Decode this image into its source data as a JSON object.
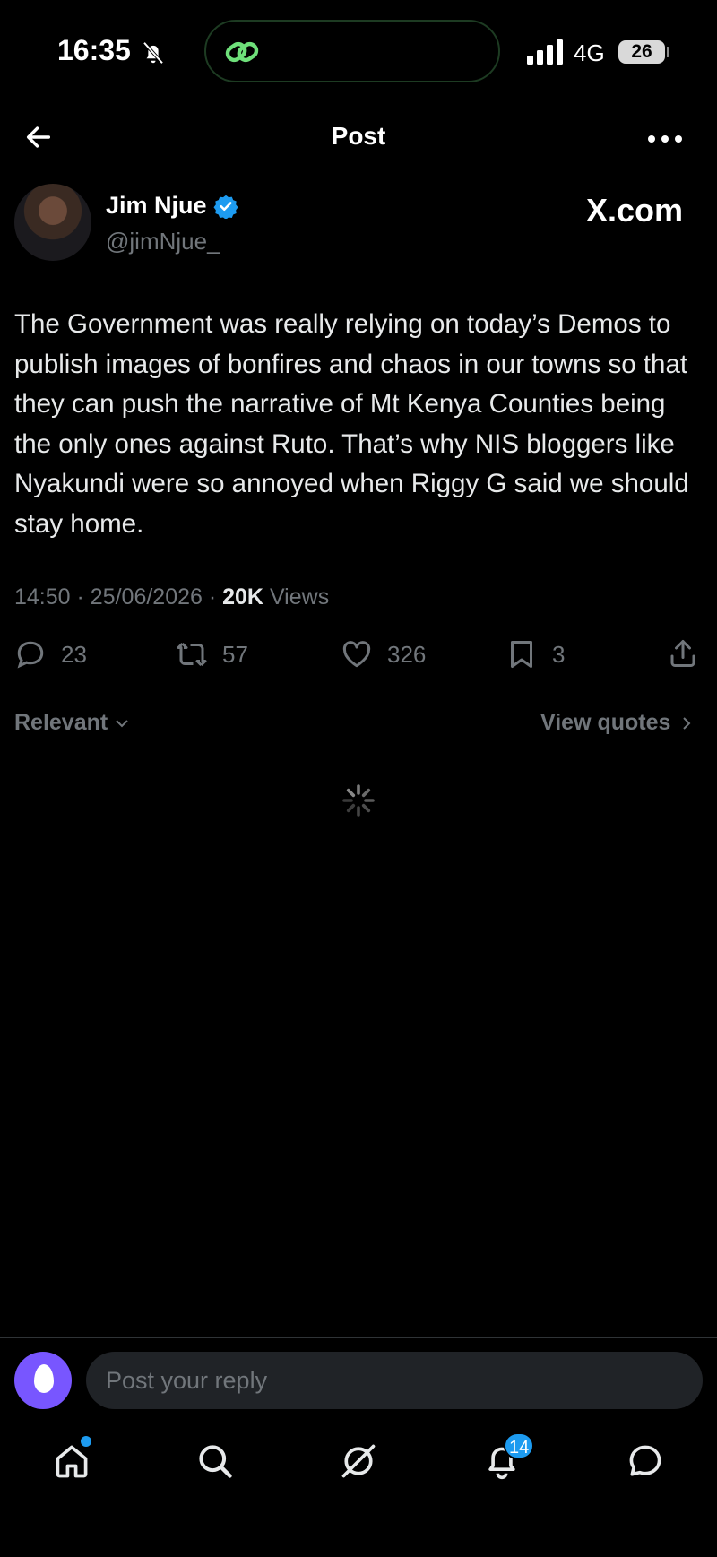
{
  "status_bar": {
    "time": "16:35",
    "network": "4G",
    "battery": "26"
  },
  "header": {
    "title": "Post"
  },
  "author": {
    "name": "Jim Njue",
    "handle": "@jimNjue_"
  },
  "watermark": "X.com",
  "post": {
    "text": "The Government was really relying on today’s Demos to publish images of bonfires and chaos in our towns so that they can push the narrative of Mt Kenya Counties being the only ones against Ruto. That’s why NIS bloggers like Nyakundi were so annoyed when Riggy G said we should stay home.",
    "time": "14:50",
    "date": "25/06/2026",
    "views_count": "20K",
    "views_label": "Views"
  },
  "actions": {
    "replies": "23",
    "reposts": "57",
    "likes": "326",
    "bookmarks": "3"
  },
  "sort": {
    "label": "Relevant"
  },
  "view_quotes": "View quotes",
  "reply": {
    "placeholder": "Post your reply"
  },
  "nav": {
    "notifications_badge": "14"
  },
  "colors": {
    "background": "#000000",
    "accent": "#1d9bf0",
    "muted": "#71767b",
    "reply_avatar": "#7856ff"
  },
  "icons": [
    "bell-slash-icon",
    "link-icon",
    "signal-icon",
    "back-arrow-icon",
    "more-icon",
    "verified-icon",
    "reply-icon",
    "repost-icon",
    "like-icon",
    "bookmark-icon",
    "share-icon",
    "chevron-down-icon",
    "chevron-right-icon",
    "loading-spinner-icon",
    "home-icon",
    "search-icon",
    "grok-icon",
    "notifications-icon",
    "messages-icon"
  ]
}
